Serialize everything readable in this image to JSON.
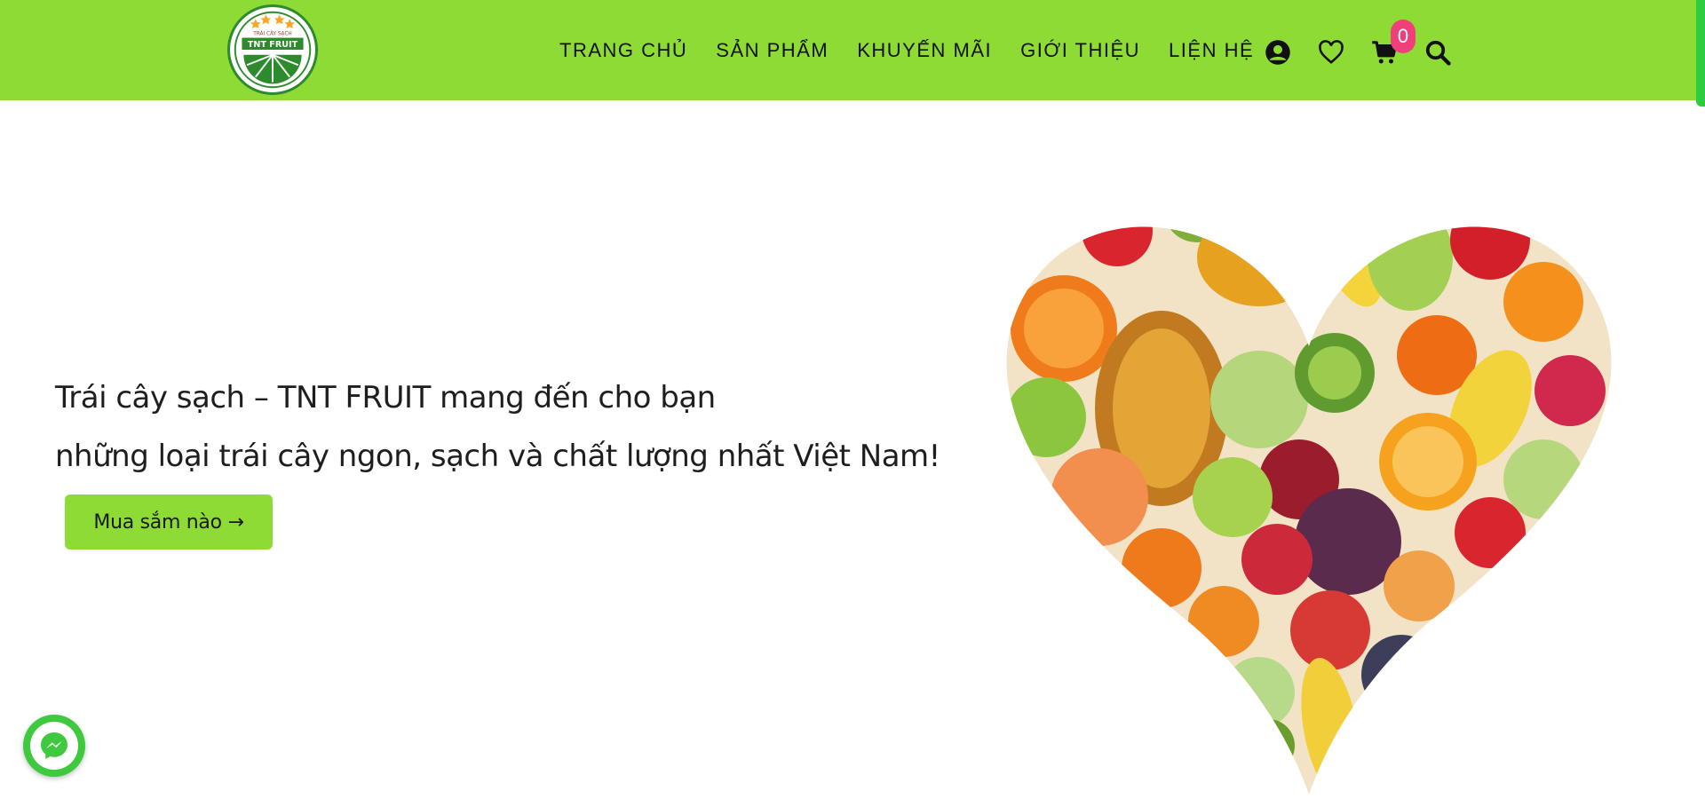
{
  "header": {
    "logo": {
      "top_text": "TRÁI CÂY SẠCH",
      "brand": "TNT FRUIT"
    },
    "nav": [
      {
        "label": "TRANG CHỦ"
      },
      {
        "label": "SẢN PHẨM"
      },
      {
        "label": "KHUYẾN MÃI"
      },
      {
        "label": "GIỚI THIỆU"
      },
      {
        "label": "LIỆN HỆ"
      }
    ],
    "icons": [
      "user-icon",
      "heart-icon",
      "cart-icon",
      "search-icon"
    ],
    "cart_count": "0"
  },
  "hero": {
    "line1": "Trái cây sạch – TNT FRUIT mang đến cho bạn",
    "line2": "những loại trái cây ngon, sạch và chất lượng nhất Việt Nam!",
    "cta_label": "Mua sắm nào →",
    "image": "fruit-heart-image"
  },
  "chat": {
    "icon": "messenger-icon"
  },
  "colors": {
    "header_bg": "#8edb36",
    "button_bg": "#8edb36",
    "badge": "#f0407a",
    "messenger": "#3fc93f"
  }
}
